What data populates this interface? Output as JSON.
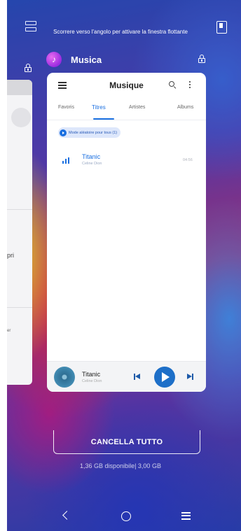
{
  "overview": {
    "hint": "Scorrere verso l'angolo per attivare la finestra flottante",
    "previous_card": {
      "partial_text_1": "pri",
      "partial_text_2": "er"
    },
    "app": {
      "name": "Musica",
      "icon": "music-note-icon"
    }
  },
  "music_app": {
    "title": "Musique",
    "tabs": [
      {
        "label": "Favoris",
        "active": false
      },
      {
        "label": "Titres",
        "active": true
      },
      {
        "label": "Artistes",
        "active": false
      },
      {
        "label": "Albums",
        "active": false
      }
    ],
    "shuffle_label": "Mode aléatoire pour tous (1)",
    "songs": [
      {
        "title": "Titanic",
        "artist": "Celine Dion",
        "duration": "04:56"
      }
    ],
    "player": {
      "title": "Titanic",
      "artist": "Celine Dion"
    }
  },
  "footer": {
    "clear_all_label": "CANCELLA TUTTO",
    "memory_text": "1,36 GB disponibile| 3,00 GB"
  },
  "colors": {
    "accent": "#1a6fe0",
    "play_button": "#1d6fc8"
  }
}
